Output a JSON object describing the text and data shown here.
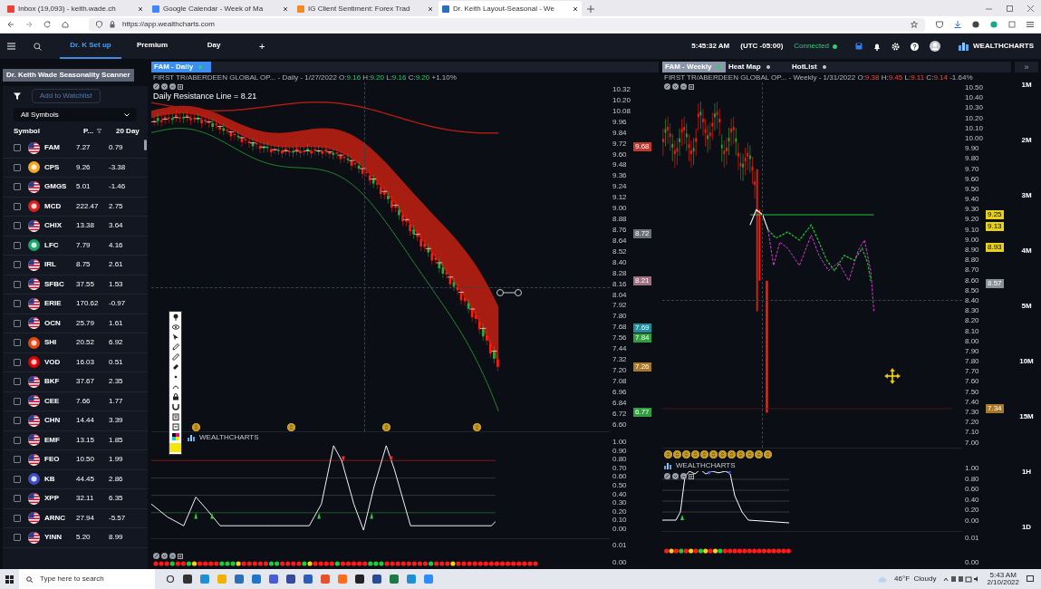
{
  "browser": {
    "tabs": [
      {
        "label": "Inbox (19,093) - keith.wade.ch",
        "selected": false
      },
      {
        "label": "Google Calendar - Week of Ma",
        "selected": false
      },
      {
        "label": "IG Client Sentiment: Forex Trad",
        "selected": false
      },
      {
        "label": "Dr. Keith Layout-Seasonal - We",
        "selected": true
      }
    ],
    "url": "https://app.wealthcharts.com"
  },
  "app_header": {
    "tabs": [
      {
        "label": "Dr. K Set up",
        "selected": true
      },
      {
        "label": "Premium",
        "selected": false
      },
      {
        "label": "Day",
        "selected": false
      }
    ],
    "add": "+",
    "time": "5:45:32 AM",
    "timezone": "(UTC -05:00)",
    "status": "Connected",
    "logo": "WEALTHCHARTS"
  },
  "scanner": {
    "title": "Dr. Keith Wade Seasonality Scanner",
    "add_button": "Add to Watchlist",
    "filter": "All Symbols",
    "columns": [
      "Symbol",
      "P...",
      "20 Day"
    ],
    "rows": [
      {
        "kind": "flag",
        "checked": false,
        "symbol": "FAM",
        "price": "7.27",
        "change": "0.79"
      },
      {
        "kind": "logo",
        "checked": false,
        "color": "#f5a623",
        "symbol": "CPS",
        "price": "9.26",
        "change": "-3.38"
      },
      {
        "kind": "flag",
        "checked": false,
        "symbol": "GMGS",
        "price": "5.01",
        "change": "-1.46"
      },
      {
        "kind": "logo",
        "checked": false,
        "color": "#d6201f",
        "symbol": "MCD",
        "price": "222.47",
        "change": "2.75"
      },
      {
        "kind": "flag",
        "checked": false,
        "symbol": "CHIX",
        "price": "13.38",
        "change": "3.64"
      },
      {
        "kind": "logo",
        "checked": false,
        "color": "#1aa36b",
        "symbol": "LFC",
        "price": "7.79",
        "change": "4.16"
      },
      {
        "kind": "flag",
        "checked": false,
        "symbol": "IRL",
        "price": "8.75",
        "change": "2.61"
      },
      {
        "kind": "flag",
        "checked": false,
        "symbol": "SFBC",
        "price": "37.55",
        "change": "1.53"
      },
      {
        "kind": "flag",
        "checked": false,
        "symbol": "ERIE",
        "price": "170.62",
        "change": "-0.97"
      },
      {
        "kind": "flag",
        "checked": false,
        "symbol": "OCN",
        "price": "25.79",
        "change": "1.61"
      },
      {
        "kind": "logo",
        "checked": false,
        "color": "#e8470f",
        "symbol": "SHI",
        "price": "20.52",
        "change": "6.92"
      },
      {
        "kind": "logo",
        "checked": false,
        "color": "#e60000",
        "symbol": "VOD",
        "price": "16.03",
        "change": "0.51"
      },
      {
        "kind": "flag",
        "checked": false,
        "symbol": "BKF",
        "price": "37.67",
        "change": "2.35"
      },
      {
        "kind": "flag",
        "checked": false,
        "symbol": "CEE",
        "price": "7.66",
        "change": "1.77"
      },
      {
        "kind": "flag",
        "checked": false,
        "symbol": "CHN",
        "price": "14.44",
        "change": "3.39"
      },
      {
        "kind": "flag",
        "checked": false,
        "symbol": "EMF",
        "price": "13.15",
        "change": "1.85"
      },
      {
        "kind": "flag",
        "checked": false,
        "symbol": "FEO",
        "price": "10.50",
        "change": "1.99"
      },
      {
        "kind": "logo",
        "checked": false,
        "color": "#3b4fc4",
        "symbol": "KB",
        "price": "44.45",
        "change": "2.86"
      },
      {
        "kind": "flag",
        "checked": false,
        "symbol": "XPP",
        "price": "32.11",
        "change": "6.35"
      },
      {
        "kind": "flag",
        "checked": false,
        "symbol": "ARNC",
        "price": "27.94",
        "change": "-5.57"
      },
      {
        "kind": "flag",
        "checked": false,
        "symbol": "YINN",
        "price": "5.20",
        "change": "8.99"
      }
    ]
  },
  "daily_chart": {
    "tabs": [
      {
        "label": "FAM - Daily",
        "selected": true
      }
    ],
    "info": "FIRST TR/ABERDEEN GLOBAL OP... - Daily - 1/27/2022 O:**9.16** H:**9.20** L:**9.16** C:**9.20** +1.10%",
    "study_label": "Daily Resistance Line = 8.21",
    "price_axis": [
      "10.32",
      "10.20",
      "10.08",
      "9.96",
      "9.84",
      "9.72",
      "9.60",
      "9.48",
      "9.36",
      "9.24",
      "9.12",
      "9.00",
      "8.88",
      "8.76",
      "8.64",
      "8.52",
      "8.40",
      "8.28",
      "8.16",
      "8.04",
      "7.92",
      "7.80",
      "7.68",
      "7.56",
      "7.44",
      "7.32",
      "7.20",
      "7.08",
      "6.96",
      "6.84",
      "6.72",
      "6.60"
    ],
    "price_badges": [
      {
        "text": "9.68",
        "color": "#c0392b"
      },
      {
        "text": "8.72",
        "color": "#6b6f78"
      },
      {
        "text": "8.21",
        "color": "#a07080"
      },
      {
        "text": "7.69",
        "color": "#1f8fa0"
      },
      {
        "text": "7.84",
        "color": "#2e9e3e"
      },
      {
        "text": "7.26",
        "color": "#a8782a"
      },
      {
        "text": "6.77",
        "color": "#2e9e3e"
      }
    ],
    "indicator_label": "WEALTHCHARTS",
    "indicator_axis": [
      "1.00",
      "0.90",
      "0.80",
      "0.70",
      "0.60",
      "0.50",
      "0.40",
      "0.30",
      "0.20",
      "0.10",
      "0.00"
    ],
    "strip_axis": [
      "0.01",
      "0.00"
    ]
  },
  "weekly_chart": {
    "tabs": [
      {
        "label": "FAM - Weekly",
        "selected": true
      },
      {
        "label": "Heat Map",
        "selected": false
      },
      {
        "label": "HotList",
        "selected": false
      }
    ],
    "info": "FIRST TR/ABERDEEN GLOBAL OP... - Weekly - 1/31/2022 O:**9.38** H:**9.45** L:**9.11** C:**9.14** -1.64%",
    "price_axis": [
      "10.50",
      "10.40",
      "10.30",
      "10.20",
      "10.10",
      "10.00",
      "9.90",
      "9.80",
      "9.70",
      "9.60",
      "9.50",
      "9.40",
      "9.30",
      "9.20",
      "9.10",
      "9.00",
      "8.90",
      "8.80",
      "8.70",
      "8.60",
      "8.50",
      "8.40",
      "8.30",
      "8.20",
      "8.10",
      "8.00",
      "7.90",
      "7.80",
      "7.70",
      "7.60",
      "7.50",
      "7.40",
      "7.30",
      "7.20",
      "7.10",
      "7.00"
    ],
    "price_badges": [
      {
        "text": "9.25",
        "color": "#e6d21c"
      },
      {
        "text": "9.13",
        "color": "#e6d21c"
      },
      {
        "text": "8.93",
        "color": "#e6d21c"
      },
      {
        "text": "8.57",
        "color": "#8a8f99"
      },
      {
        "text": "7.34",
        "color": "#a8782a"
      }
    ],
    "indicator_label": "WEALTHCHARTS",
    "indicator_axis": [
      "1.00",
      "0.80",
      "0.60",
      "0.40",
      "0.20",
      "0.00"
    ],
    "strip_axis": [
      "0.01",
      "0.00"
    ]
  },
  "timeframes": {
    "collapse": "»",
    "items": [
      "1M",
      "2M",
      "3M",
      "4M",
      "5M",
      "10M",
      "15M",
      "1H",
      "1D"
    ]
  },
  "taskbar": {
    "search": "Type here to search",
    "weather": "46°F  Cloudy",
    "time": "5:43 AM",
    "date": "2/10/2022"
  }
}
